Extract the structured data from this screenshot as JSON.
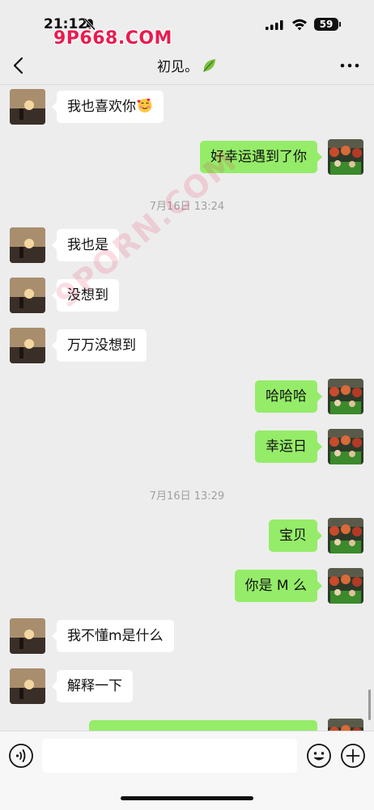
{
  "status_bar": {
    "time": "21:12",
    "battery": "59",
    "icons": [
      "bell-slash-icon",
      "signal-icon",
      "wifi-icon",
      "battery-icon"
    ]
  },
  "watermarks": {
    "top": "9P668.COM",
    "diagonal": "9PORN.COM"
  },
  "nav": {
    "title": "初见。",
    "back_icon": "chevron-left-icon",
    "more_icon": "more-icon"
  },
  "messages": [
    {
      "side": "left",
      "text": "我也喜欢你",
      "emoji": "smiling-face-with-hearts"
    },
    {
      "side": "right",
      "text": "好幸运遇到了你"
    },
    {
      "type": "time",
      "text": "7月16日 13:24"
    },
    {
      "side": "left",
      "text": "我也是"
    },
    {
      "side": "left",
      "text": "没想到"
    },
    {
      "side": "left",
      "text": "万万没想到"
    },
    {
      "side": "right",
      "text": "哈哈哈"
    },
    {
      "side": "right",
      "text": "幸运日"
    },
    {
      "type": "time",
      "text": "7月16日 13:29"
    },
    {
      "side": "right",
      "text": "宝贝"
    },
    {
      "side": "right",
      "text": "你是 M 么"
    },
    {
      "side": "left",
      "text": "我不懂m是什么"
    },
    {
      "side": "left",
      "text": "解释一下"
    }
  ],
  "colors": {
    "background": "#ededed",
    "bubble_self": "#95ec69",
    "bubble_other": "#ffffff",
    "watermark": "#e81c4f"
  },
  "input_bar": {
    "input_value": "",
    "icons": [
      "voice-icon",
      "emoji-icon",
      "add-icon"
    ]
  }
}
